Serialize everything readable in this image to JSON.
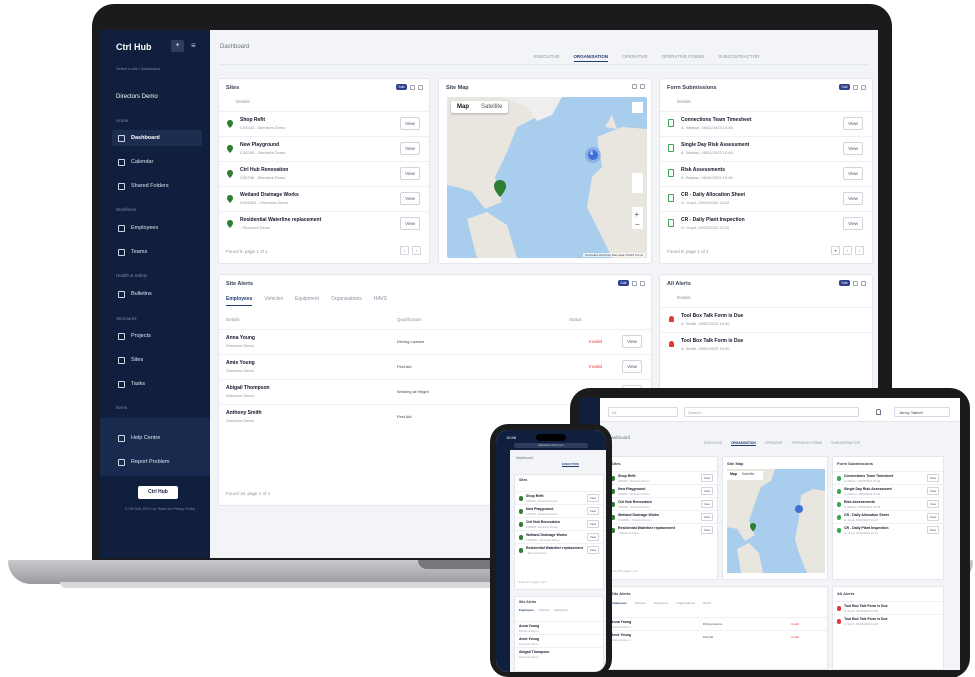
{
  "app": {
    "brand": "Ctrl Hub",
    "brand_button": "+",
    "menu_icon": "hamburger-icon",
    "user_sub": "Select a site / dashboard",
    "account": "Directors Demo"
  },
  "sidebar": {
    "sections": {
      "home": "Home",
      "workforce": "Workforce",
      "health": "Health & Safety",
      "structures": "Structures",
      "items": "Items"
    },
    "items": [
      {
        "label": "Dashboard",
        "icon": "home-icon"
      },
      {
        "label": "Calendar",
        "icon": "calendar-icon"
      },
      {
        "label": "Shared Folders",
        "icon": "folder-icon"
      },
      {
        "label": "Employees",
        "icon": "employees-icon"
      },
      {
        "label": "Teams",
        "icon": "teams-icon"
      },
      {
        "label": "Bulletins",
        "icon": "bulletin-icon"
      },
      {
        "label": "Projects",
        "icon": "projects-icon"
      },
      {
        "label": "Sites",
        "icon": "sites-icon"
      },
      {
        "label": "Tasks",
        "icon": "tasks-icon"
      }
    ],
    "help": "Help Centre",
    "report": "Report Problem",
    "logo": "Ctrl Hub",
    "footer": "© Ctrl Hub 2023 Ltd. Read our Privacy Policy"
  },
  "header": {
    "breadcrumb": "Dashboard",
    "tabs": [
      "EXECUTIVE",
      "ORGANISATION",
      "OPERATIVE",
      "OPERATIVE FORMS",
      "SUBCONTRACTOR"
    ],
    "active_tab": "ORGANISATION"
  },
  "sites": {
    "title": "Sites",
    "badge": "Sub",
    "column": "Details",
    "rows": [
      {
        "name": "Shop Refit",
        "sub": "C00243 - Directors Demo"
      },
      {
        "name": "New Playground",
        "sub": "C00256 - Directors Demo"
      },
      {
        "name": "Ctrl Hub Renovation",
        "sub": "C00248 - Directors Demo"
      },
      {
        "name": "Wetland Drainage Works",
        "sub": "KU00351 - Directors Demo"
      },
      {
        "name": "Residential Waterline replacement",
        "sub": "- Directors Demo"
      }
    ],
    "view_label": "View",
    "found": "Found 5, page 1 of 1"
  },
  "site_map": {
    "title": "Site Map",
    "tabs": [
      "Map",
      "Satellite"
    ],
    "active": "Map",
    "cluster_count": "4",
    "attribution": "Keyboard shortcuts   Map data ©2023   Terms"
  },
  "form_submissions": {
    "title": "Form Submissions",
    "badge": "Sub",
    "column": "Details",
    "rows": [
      {
        "name": "Connections Team Timesheet",
        "sub": "A. Watson, 08/02/2023 10:45"
      },
      {
        "name": "Single Day Risk Assessment",
        "sub": "A. Watson, 08/02/2023 10:45"
      },
      {
        "name": "Risk Assessments",
        "sub": "A. Watson, 08/02/2023 10:45"
      },
      {
        "name": "CR - Daily Allocation Sheet",
        "sub": "G. Lloyd, 03/02/2023 15:22"
      },
      {
        "name": "CR - Daily Plant Inspection",
        "sub": "G. Lloyd, 03/02/2023 15:22"
      }
    ],
    "view_label": "View",
    "found": "Found 8, page 1 of 2"
  },
  "site_alerts": {
    "title": "Site Alerts",
    "badge": "Sub",
    "tabs": [
      "Employees",
      "Vehicles",
      "Equipment",
      "Organisations",
      "HAVS"
    ],
    "active_tab": "Employees",
    "columns": [
      "Details",
      "Qualification",
      "Status"
    ],
    "rows": [
      {
        "name": "Anna Young",
        "sub": "Directors Demo",
        "qual": "Driving Licence",
        "status": "Invalid"
      },
      {
        "name": "Amie Young",
        "sub": "Directors Demo",
        "qual": "First Aid",
        "status": "Invalid"
      },
      {
        "name": "Abigail Thompson",
        "sub": "Directors Demo",
        "qual": "Working at Height",
        "status": "Invalid"
      },
      {
        "name": "Anthony Smith",
        "sub": "Directors Demo",
        "qual": "First Aid",
        "status": ""
      }
    ],
    "view_label": "View",
    "found": "Found 16, page 1 of 4"
  },
  "all_alerts": {
    "title": "All Alerts",
    "badge": "Sub",
    "column": "Details",
    "rows": [
      {
        "name": "Tool Box Talk Form is Due",
        "sub": "A. Smith, 08/02/2023 10:00"
      },
      {
        "name": "Tool Box Talk Form is Due",
        "sub": "A. Smith, 08/02/2023 10:00"
      }
    ]
  },
  "tablet": {
    "search_scope": "All",
    "search_placeholder": "Search...",
    "user": "Jenny Tabnet",
    "breadcrumb": "Dashboard",
    "map_tabs": [
      "Map",
      "Satellite"
    ]
  },
  "phone": {
    "time": "10:58",
    "url": "dashboard.ctrlhub.com",
    "breadcrumb": "Dashboard",
    "tab": "EXECUTIVE",
    "cards": [
      "Sites",
      "Site Alerts"
    ],
    "found": "Found 5, page 1 of 1"
  },
  "colors": {
    "sidebar": "#0f1f3d",
    "accent": "#1f3b73",
    "site_pin": "#2e7d32",
    "alert": "#e53935",
    "map_water": "#a9cdec",
    "map_land": "#e8e6df"
  }
}
